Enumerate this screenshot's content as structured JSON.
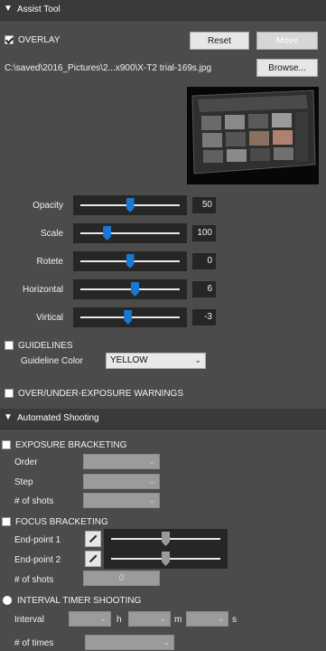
{
  "assist_tool": {
    "title": "Assist Tool",
    "overlay_label": "OVERLAY",
    "overlay_checked": true,
    "reset_label": "Reset",
    "move_label": "Move",
    "file_path": "C:\\saved\\2016_Pictures\\2...x900\\X-T2 trial-169s.jpg",
    "browse_label": "Browse...",
    "sliders": [
      {
        "label": "Opacity",
        "value": "50",
        "position": 0.5
      },
      {
        "label": "Scale",
        "value": "100",
        "position": 0.27
      },
      {
        "label": "Rotete",
        "value": "0",
        "position": 0.5
      },
      {
        "label": "Horizontal",
        "value": "6",
        "position": 0.55
      },
      {
        "label": "Virtical",
        "value": "-3",
        "position": 0.48
      }
    ],
    "guidelines_label": "GUIDELINES",
    "guideline_color_label": "Guideline Color",
    "guideline_color_value": "YELLOW",
    "exposure_warnings_label": "OVER/UNDER-EXPOSURE WARNINGS"
  },
  "automated_shooting": {
    "title": "Automated Shooting",
    "exposure_bracketing_label": "EXPOSURE BRACKETING",
    "order_label": "Order",
    "step_label": "Step",
    "shots_label": "# of shots",
    "focus_bracketing_label": "FOCUS BRACKETING",
    "endpoint1_label": "End-point 1",
    "endpoint2_label": "End-point 2",
    "endpoint1_position": 0.5,
    "endpoint2_position": 0.5,
    "focus_shots_label": "# of shots",
    "focus_shots_value": "0",
    "interval_label": "INTERVAL TIMER SHOOTING",
    "interval_field_label": "Interval",
    "h_label": "h",
    "m_label": "m",
    "s_label": "s",
    "times_label": "# of times"
  },
  "icons": {
    "collapse": "triangle-down",
    "edit": "pencil"
  }
}
